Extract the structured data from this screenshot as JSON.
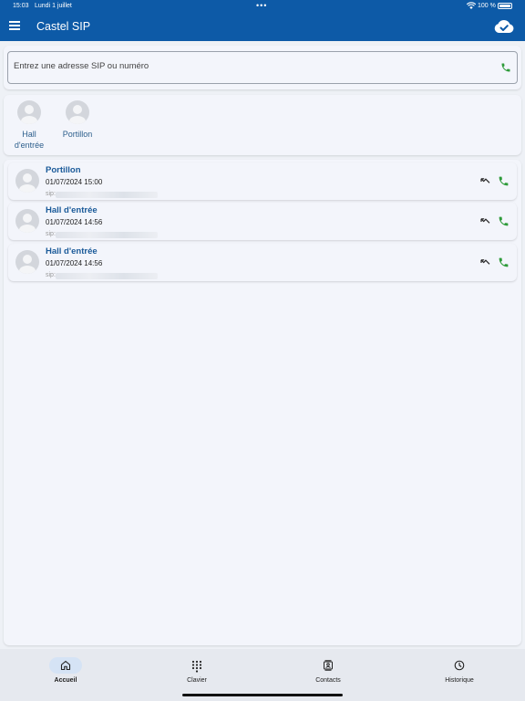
{
  "status_bar": {
    "time": "15:03",
    "date": "Lundi 1 juillet",
    "dots": "•••",
    "battery": "100 %"
  },
  "app_bar": {
    "title": "Castel SIP"
  },
  "search": {
    "placeholder": "Entrez une adresse SIP ou numéro"
  },
  "favorites": [
    {
      "label_line1": "Hall",
      "label_line2": "d'entrée"
    },
    {
      "label_line1": "Portillon",
      "label_line2": ""
    }
  ],
  "calls": [
    {
      "name": "Portillon",
      "datetime": "01/07/2024 15:00",
      "sip_prefix": "sip:"
    },
    {
      "name": "Hall d'entrée",
      "datetime": "01/07/2024 14:56",
      "sip_prefix": "sip:"
    },
    {
      "name": "Hall d'entrée",
      "datetime": "01/07/2024 14:56",
      "sip_prefix": "sip:"
    }
  ],
  "nav": [
    {
      "label": "Accueil",
      "icon": "home-icon",
      "active": true
    },
    {
      "label": "Clavier",
      "icon": "dialpad-icon",
      "active": false
    },
    {
      "label": "Contacts",
      "icon": "contacts-icon",
      "active": false
    },
    {
      "label": "Historique",
      "icon": "history-icon",
      "active": false
    }
  ],
  "colors": {
    "primary": "#0d5aa7",
    "call_green": "#2e9b3a",
    "name_blue": "#1a5a99",
    "nav_active": "#d5e3f5"
  }
}
